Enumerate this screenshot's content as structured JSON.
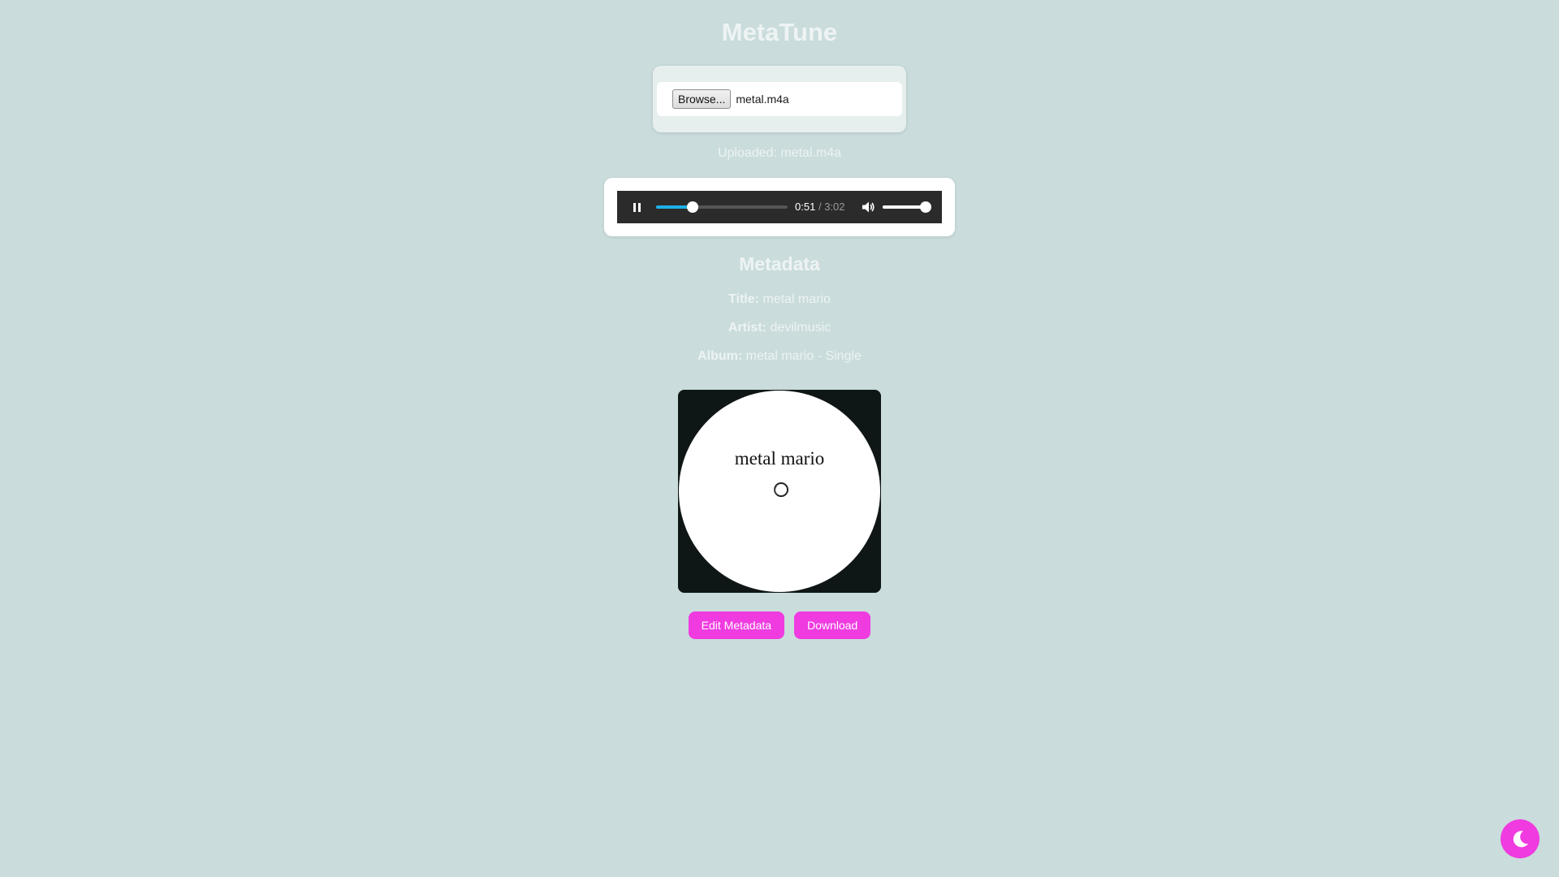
{
  "app": {
    "title": "MetaTune"
  },
  "upload": {
    "browse_label": "Browse...",
    "file_name": "metal.m4a",
    "uploaded_prefix": "Uploaded:",
    "uploaded_file": "metal.m4a"
  },
  "player": {
    "state": "playing",
    "current_time": "0:51",
    "separator": "/",
    "duration": "3:02",
    "progress_fraction": 0.28,
    "volume_fraction": 0.95,
    "seek_color": "#1eb1e6"
  },
  "metadata": {
    "heading": "Metadata",
    "title_label": "Title:",
    "title_value": "metal mario",
    "artist_label": "Artist:",
    "artist_value": "devilmusic",
    "album_label": "Album:",
    "album_value": "metal mario - Single"
  },
  "cover": {
    "text": "metal mario"
  },
  "actions": {
    "edit_label": "Edit Metadata",
    "download_label": "Download"
  },
  "theme_toggle": {
    "icon": "moon-icon"
  },
  "colors": {
    "background": "#cadcdc",
    "accent": "#ef3be0"
  }
}
